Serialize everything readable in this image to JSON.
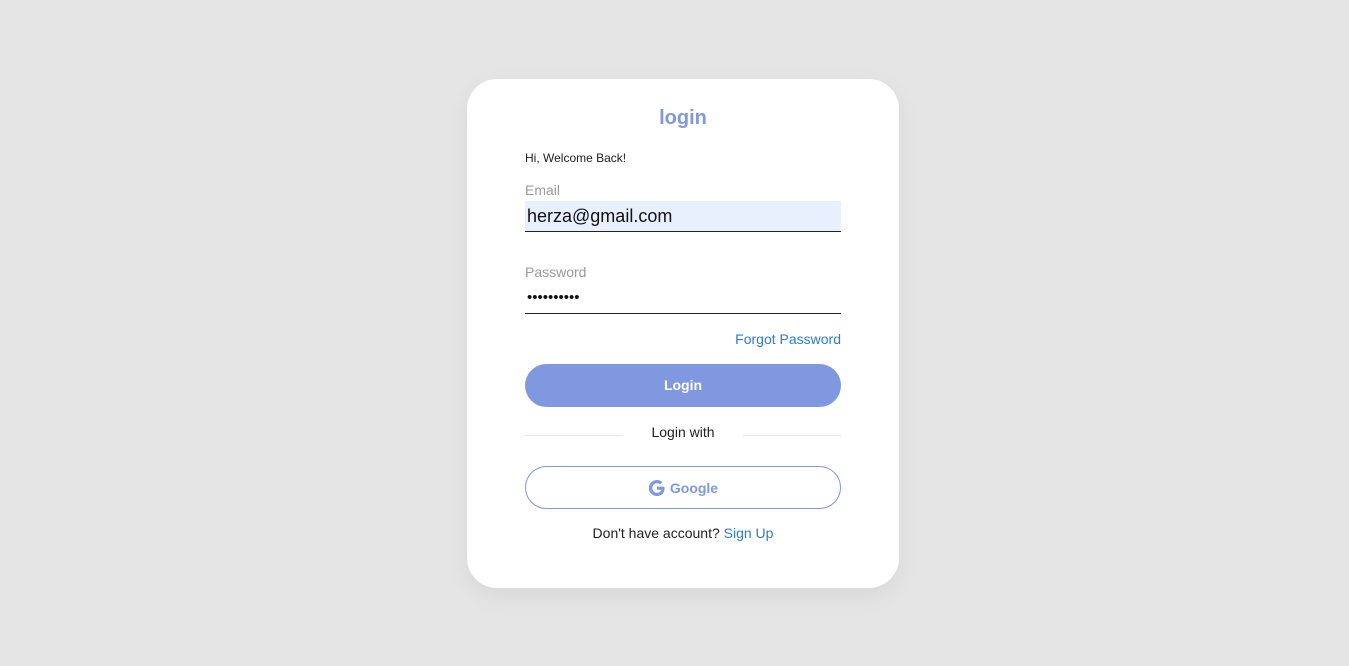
{
  "card": {
    "title": "login",
    "welcome": "Hi, Welcome Back!"
  },
  "email": {
    "label": "Email",
    "value": "herza@gmail.com"
  },
  "password": {
    "label": "Password",
    "value": "••••••••••"
  },
  "forgot_label": "Forgot Password",
  "login_button_label": "Login",
  "divider_label": "Login with",
  "google": {
    "icon": "google-icon",
    "label": "Google"
  },
  "signup": {
    "prompt": "Don't have account?",
    "link_label": "Sign Up"
  },
  "colors": {
    "accent": "#7f98e0",
    "link": "#2b7bd8",
    "background": "#e5e5e5",
    "input_autofill": "#e8f0fe"
  }
}
